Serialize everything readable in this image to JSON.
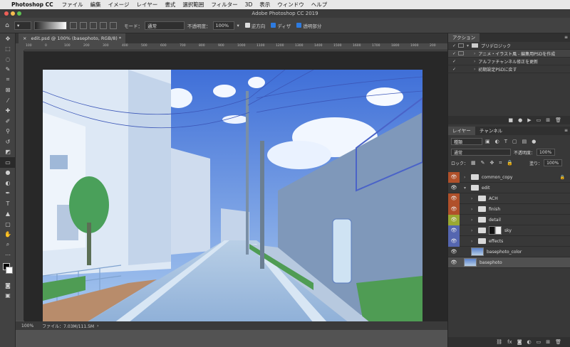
{
  "menubar": {
    "app_name": "Photoshop CC",
    "items": [
      "ファイル",
      "編集",
      "イメージ",
      "レイヤー",
      "書式",
      "選択範囲",
      "フィルター",
      "3D",
      "表示",
      "ウィンドウ",
      "ヘルプ"
    ]
  },
  "window": {
    "title": "Adobe Photoshop CC 2019"
  },
  "options": {
    "mode_label": "モード：",
    "mode_value": "通常",
    "opacity_label": "不透明度：",
    "opacity_value": "100%",
    "reverse_label": "逆方向",
    "dither_label": "ディザ",
    "transparency_label": "透明部分"
  },
  "document": {
    "tab_title": "edit.psd @ 100% (basephoto, RGB/8) *",
    "zoom": "100%",
    "file_info": "ファイル：7.03M/111.5M"
  },
  "ruler": {
    "top_ticks": [
      "100",
      "0",
      "100",
      "200",
      "300",
      "400",
      "500",
      "600",
      "700",
      "800",
      "900",
      "1000",
      "1100",
      "1200",
      "1300",
      "1400",
      "1500",
      "1600",
      "1700",
      "1800",
      "1900",
      "200"
    ]
  },
  "actions_panel": {
    "tab_label": "アクション",
    "rows": [
      {
        "label": "プリデロジック",
        "level": 0
      },
      {
        "label": "アニメ・イラスト風 - 編集用PSDを作成",
        "level": 1
      },
      {
        "label": "アルファチャンネル修正を更新",
        "level": 1
      },
      {
        "label": "初期設定PSDに戻す",
        "level": 1
      }
    ]
  },
  "layers_panel": {
    "tab_layers": "レイヤー",
    "tab_channels": "チャンネル",
    "filter_label": "種類",
    "blend_mode": "通常",
    "opacity_label": "不透明度：",
    "opacity_value": "100%",
    "lock_label": "ロック：",
    "fill_label": "塗り：",
    "fill_value": "100%",
    "layers": [
      {
        "name": "common_copy",
        "kind": "folder",
        "indent": 0,
        "eye_color": "#b0502a"
      },
      {
        "name": "edit",
        "kind": "folder",
        "indent": 0,
        "eye_color": ""
      },
      {
        "name": "ACH",
        "kind": "folder",
        "indent": 1,
        "eye_color": "#b0502a"
      },
      {
        "name": "finish",
        "kind": "folder",
        "indent": 1,
        "eye_color": "#b0502a"
      },
      {
        "name": "detail",
        "kind": "folder",
        "indent": 1,
        "eye_color": "#9aa832"
      },
      {
        "name": "sky",
        "kind": "folder-mask",
        "indent": 1,
        "eye_color": "#5566b0"
      },
      {
        "name": "effects",
        "kind": "folder",
        "indent": 1,
        "eye_color": "#5566b0"
      },
      {
        "name": "basephoto_color",
        "kind": "image",
        "indent": 1,
        "eye_color": ""
      },
      {
        "name": "basephoto",
        "kind": "image",
        "indent": 0,
        "eye_color": ""
      }
    ]
  },
  "colors": {
    "accent": "#2d7be0"
  }
}
